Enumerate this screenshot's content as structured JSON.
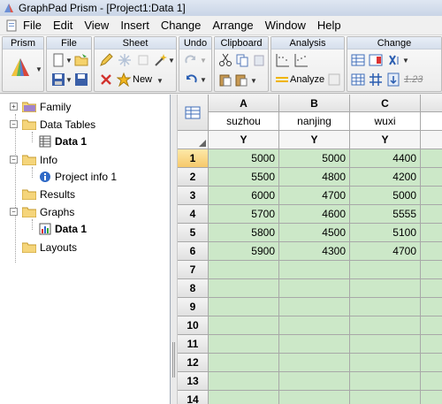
{
  "title": "GraphPad Prism - [Project1:Data 1]",
  "menu": [
    "File",
    "Edit",
    "View",
    "Insert",
    "Change",
    "Arrange",
    "Window",
    "Help"
  ],
  "toolbar": {
    "groups": [
      "Prism",
      "File",
      "Sheet",
      "Undo",
      "Clipboard",
      "Analysis",
      "Change"
    ],
    "new_label": "New",
    "analyze_label": "Analyze",
    "change_text_icon": "1.23"
  },
  "tree": {
    "family": "Family",
    "data_tables": "Data Tables",
    "data_tables_child": "Data 1",
    "info": "Info",
    "info_child": "Project info 1",
    "results": "Results",
    "graphs": "Graphs",
    "graphs_child": "Data 1",
    "layouts": "Layouts"
  },
  "sheet": {
    "columns": [
      {
        "letter": "A",
        "name": "suzhou",
        "sub": "Y"
      },
      {
        "letter": "B",
        "name": "nanjing",
        "sub": "Y"
      },
      {
        "letter": "C",
        "name": "wuxi",
        "sub": "Y"
      }
    ],
    "rows": [
      {
        "num": "1",
        "values": [
          "5000",
          "5000",
          "4400"
        ]
      },
      {
        "num": "2",
        "values": [
          "5500",
          "4800",
          "4200"
        ]
      },
      {
        "num": "3",
        "values": [
          "6000",
          "4700",
          "5000"
        ]
      },
      {
        "num": "4",
        "values": [
          "5700",
          "4600",
          "5555"
        ]
      },
      {
        "num": "5",
        "values": [
          "5800",
          "4500",
          "5100"
        ]
      },
      {
        "num": "6",
        "values": [
          "5900",
          "4300",
          "4700"
        ]
      },
      {
        "num": "7",
        "values": [
          "",
          "",
          ""
        ]
      },
      {
        "num": "8",
        "values": [
          "",
          "",
          ""
        ]
      },
      {
        "num": "9",
        "values": [
          "",
          "",
          ""
        ]
      },
      {
        "num": "10",
        "values": [
          "",
          "",
          ""
        ]
      },
      {
        "num": "11",
        "values": [
          "",
          "",
          ""
        ]
      },
      {
        "num": "12",
        "values": [
          "",
          "",
          ""
        ]
      },
      {
        "num": "13",
        "values": [
          "",
          "",
          ""
        ]
      },
      {
        "num": "14",
        "values": [
          "",
          "",
          ""
        ]
      }
    ]
  },
  "colors": {
    "data_cell": "#cce8c8",
    "selected_row": "#f6c96b"
  }
}
